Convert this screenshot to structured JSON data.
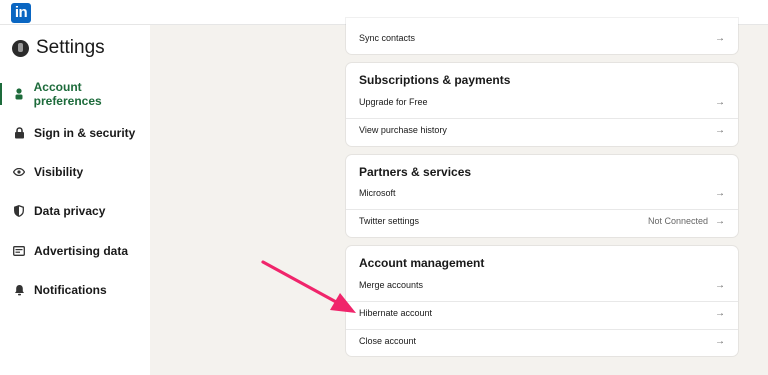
{
  "header": {
    "logo_text": "in"
  },
  "sidebar": {
    "title": "Settings",
    "items": [
      {
        "label": "Account preferences",
        "icon": "person-icon",
        "active": true
      },
      {
        "label": "Sign in & security",
        "icon": "lock-icon"
      },
      {
        "label": "Visibility",
        "icon": "eye-icon"
      },
      {
        "label": "Data privacy",
        "icon": "shield-icon"
      },
      {
        "label": "Advertising data",
        "icon": "ad-icon"
      },
      {
        "label": "Notifications",
        "icon": "bell-icon"
      }
    ]
  },
  "main": {
    "sync": {
      "label": "Sync contacts"
    },
    "subscriptions": {
      "title": "Subscriptions & payments",
      "rows": [
        {
          "label": "Upgrade for Free"
        },
        {
          "label": "View purchase history"
        }
      ]
    },
    "partners": {
      "title": "Partners & services",
      "rows": [
        {
          "label": "Microsoft",
          "status": ""
        },
        {
          "label": "Twitter settings",
          "status": "Not Connected"
        }
      ]
    },
    "account_management": {
      "title": "Account management",
      "rows": [
        {
          "label": "Merge accounts"
        },
        {
          "label": "Hibernate account"
        },
        {
          "label": "Close account"
        }
      ]
    },
    "arrow_glyph": "→"
  },
  "colors": {
    "brand": "#0a66c2",
    "active": "#1d6b3b",
    "annotation": "#f0256b",
    "background": "#f4f2ee"
  }
}
